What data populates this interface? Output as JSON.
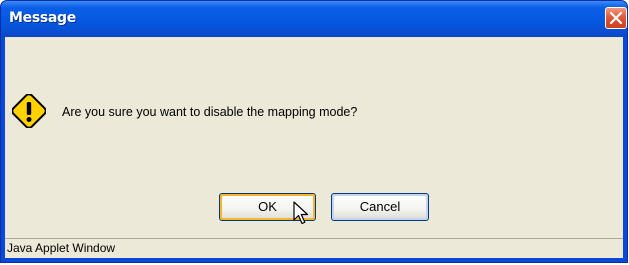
{
  "window": {
    "title": "Message",
    "close_icon": "close-icon"
  },
  "dialog": {
    "icon": "warning-icon",
    "message": "Are you sure you want to disable the mapping mode?",
    "ok_label": "OK",
    "cancel_label": "Cancel"
  },
  "status_bar": {
    "text": "Java Applet Window"
  },
  "colors": {
    "title_bar": "#0458e0",
    "dialog_bg": "#ece9d8",
    "close_button": "#e0593b",
    "warning_yellow": "#ffd200",
    "default_button_highlight": "#f8b330"
  }
}
